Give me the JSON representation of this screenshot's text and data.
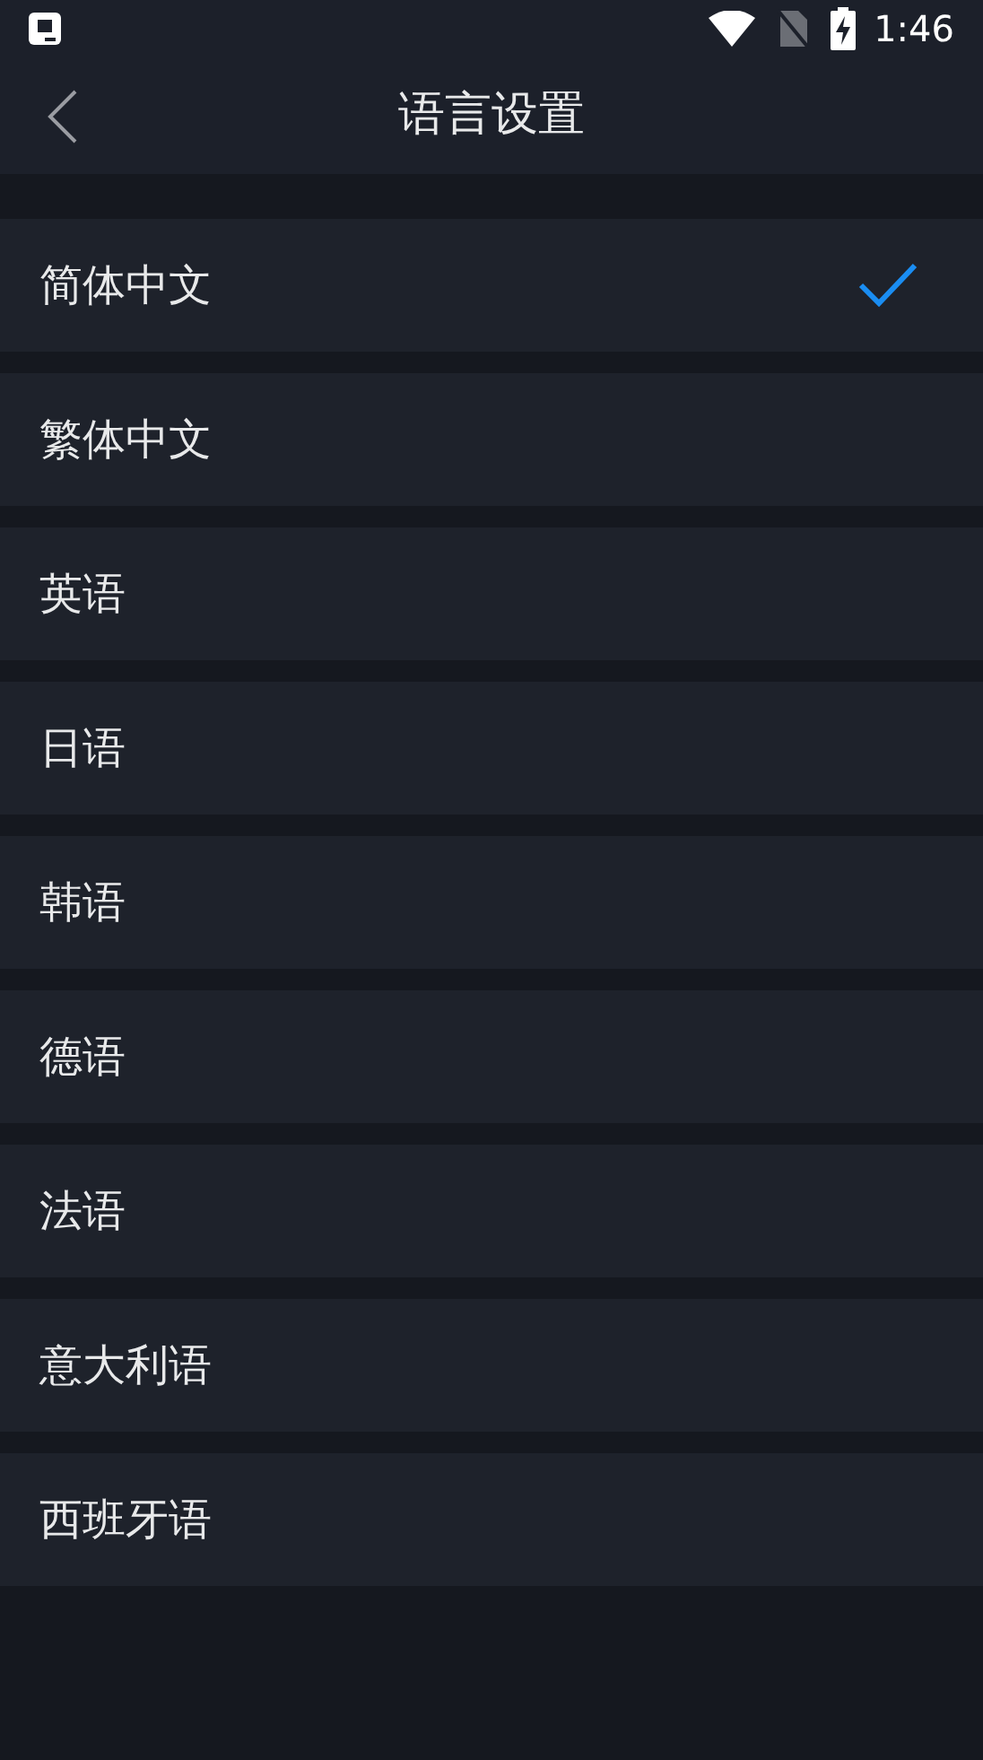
{
  "status_bar": {
    "time": "1:46"
  },
  "header": {
    "title": "语言设置"
  },
  "languages": [
    {
      "label": "简体中文",
      "selected": true
    },
    {
      "label": "繁体中文",
      "selected": false
    },
    {
      "label": "英语",
      "selected": false
    },
    {
      "label": "日语",
      "selected": false
    },
    {
      "label": "韩语",
      "selected": false
    },
    {
      "label": "德语",
      "selected": false
    },
    {
      "label": "法语",
      "selected": false
    },
    {
      "label": "意大利语",
      "selected": false
    },
    {
      "label": "西班牙语",
      "selected": false
    }
  ]
}
